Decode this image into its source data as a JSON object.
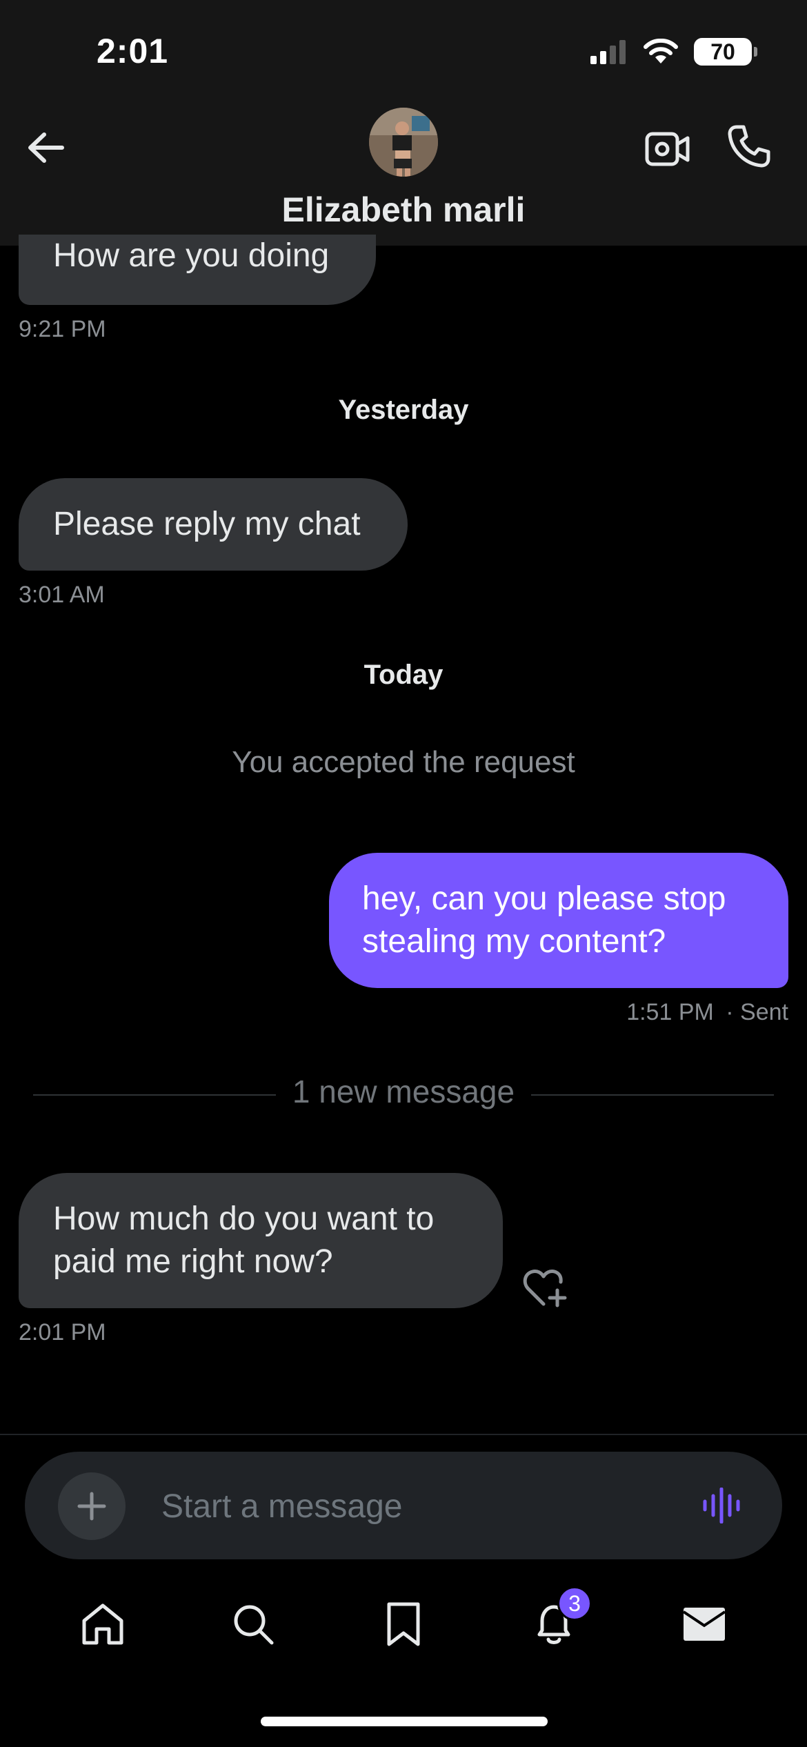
{
  "status_bar": {
    "time": "2:01",
    "battery": "70"
  },
  "header": {
    "contact_name": "Elizabeth marli"
  },
  "messages": [
    {
      "direction": "in",
      "text": "How are you doing",
      "time": "9:21 PM"
    },
    {
      "separator": "Yesterday"
    },
    {
      "direction": "in",
      "text": "Please reply my chat",
      "time": "3:01 AM"
    },
    {
      "separator": "Today"
    },
    {
      "system": "You accepted the request"
    },
    {
      "direction": "out",
      "text_line1": "hey, can you please stop",
      "text_line2": "stealing my content?",
      "time": "1:51 PM",
      "status": "· Sent"
    },
    {
      "divider": "1 new message"
    },
    {
      "direction": "in",
      "text_line1": "How much do you want to",
      "text_line2": "paid me right now?",
      "time": "2:01 PM"
    }
  ],
  "composer": {
    "placeholder": "Start a message"
  },
  "tab_bar": {
    "tabs": [
      "home",
      "search",
      "bookmarks",
      "notifications",
      "messages"
    ],
    "notification_count": "3"
  },
  "colors": {
    "accent": "#7856ff",
    "incoming_bubble": "#333538",
    "background": "#000000",
    "header": "#161616"
  },
  "icons": [
    "back-arrow-icon",
    "video-call-icon",
    "phone-icon",
    "plus-icon",
    "voice-wave-icon",
    "heart-plus-icon",
    "home-icon",
    "search-icon",
    "bookmark-icon",
    "bell-icon",
    "mail-icon"
  ]
}
